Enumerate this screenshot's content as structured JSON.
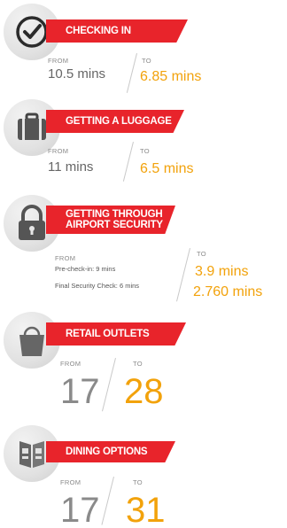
{
  "sections": [
    {
      "title": "Checking in",
      "icon": "checkmark-icon",
      "from_label": "FROM",
      "to_label": "TO",
      "from_value": "10.5 mins",
      "to_value": "6.85 mins"
    },
    {
      "title": "Getting a luggage",
      "icon": "luggage-icon",
      "from_label": "FROM",
      "to_label": "TO",
      "from_value": "11 mins",
      "to_value": "6.5 mins"
    },
    {
      "title_line1": "Getting through",
      "title_line2": "airport security",
      "icon": "padlock-icon",
      "from_label": "FROM",
      "to_label": "TO",
      "from_detail1": "Pre-check-in: 9 mins",
      "from_detail2": "Final Security Check: 6 mins",
      "to_value1": "3.9 mins",
      "to_value2": "2.760 mins"
    },
    {
      "title": "Retail outlets",
      "icon": "shopping-bag-icon",
      "from_label": "FROM",
      "to_label": "TO",
      "from_value": "17",
      "to_value": "28"
    },
    {
      "title": "Dining options",
      "icon": "menu-booklet-icon",
      "from_label": "FROM",
      "to_label": "TO",
      "from_value": "17",
      "to_value": "31"
    }
  ],
  "colors": {
    "banner_red": "#e8242b",
    "accent_orange": "#f2a20b",
    "from_gray": "#666666"
  }
}
